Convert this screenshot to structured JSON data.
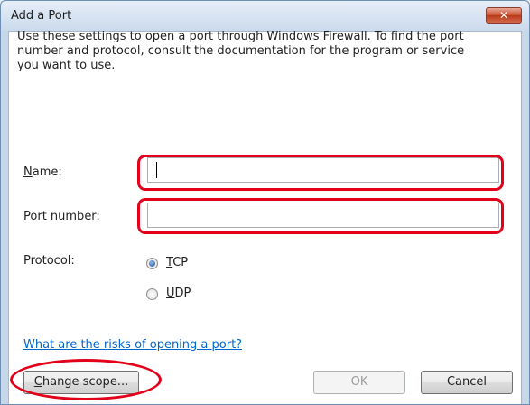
{
  "window": {
    "title": "Add a Port",
    "close_glyph": "✕"
  },
  "description": "Use these settings to open a port through Windows Firewall. To find the port number and protocol, consult the documentation for the program or service you want to use.",
  "fields": {
    "name": {
      "label_access_key": "N",
      "label_rest": "ame:",
      "value": ""
    },
    "port_number": {
      "label_access_key": "P",
      "label_rest": "ort number:",
      "value": ""
    }
  },
  "protocol": {
    "label": "Protocol:",
    "options": [
      {
        "access_key": "T",
        "rest": "CP",
        "checked": true
      },
      {
        "access_key": "U",
        "rest": "DP",
        "checked": false
      }
    ]
  },
  "risk_link": "What are the risks of opening a port?",
  "buttons": {
    "change_scope_access_key": "C",
    "change_scope_rest": "hange scope...",
    "ok": "OK",
    "cancel": "Cancel"
  },
  "colors": {
    "highlight": "#e3001b",
    "link": "#0066cc"
  }
}
